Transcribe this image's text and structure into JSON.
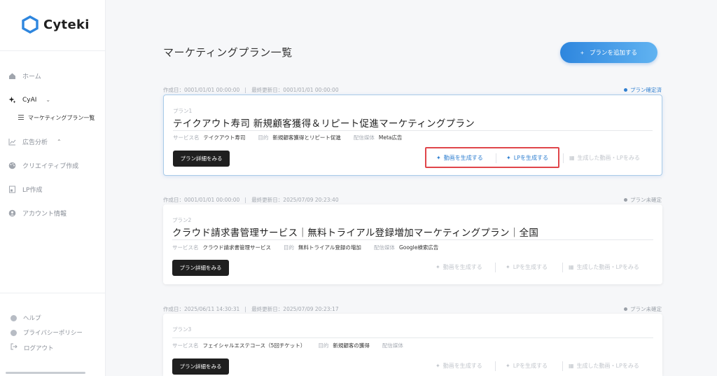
{
  "brand": {
    "name": "Cyteki",
    "accent": "#2e86de"
  },
  "sidebar": {
    "nav": [
      {
        "label": "ホーム",
        "icon": "home-icon"
      },
      {
        "label": "CyAI",
        "icon": "sparkle-icon",
        "expanded": true
      },
      {
        "label": "広告分析",
        "icon": "chart-icon"
      },
      {
        "label": "クリエイティブ作成",
        "icon": "palette-icon"
      },
      {
        "label": "LP作成",
        "icon": "document-icon"
      },
      {
        "label": "アカウント情報",
        "icon": "user-icon"
      }
    ],
    "sub_item": {
      "label": "マーケティングプラン一覧",
      "icon": "list-icon"
    },
    "bottom": [
      {
        "label": "ヘルプ",
        "icon": "help-icon"
      },
      {
        "label": "プライバシーポリシー",
        "icon": "info-icon"
      },
      {
        "label": "ログアウト",
        "icon": "logout-icon"
      }
    ]
  },
  "main": {
    "title": "マーケティングプラン一覧",
    "add_button": "プランを追加する",
    "labels": {
      "created": "作成日：",
      "updated": "最終更新日：",
      "service": "サービス名",
      "objective": "目的",
      "media": "配信媒体",
      "detail_button": "プラン詳細をみる",
      "gen_video": "動画を生成する",
      "gen_lp": "LPを生成する",
      "view_generated": "生成した動画・LPをみる"
    },
    "plans": [
      {
        "created": "0001/01/01 00:00:00",
        "updated": "0001/01/01 00:00:00",
        "status": "プラン確定済",
        "number": "プラン1",
        "title": "テイクアウト寿司 新規顧客獲得＆リピート促進マーケティングプラン",
        "service": "テイクアウト寿司",
        "objective": "新規顧客獲得とリピート促進",
        "media": "Meta広告"
      },
      {
        "created": "0001/01/01 00:00:00",
        "updated": "2025/07/09 20:23:40",
        "status": "プラン未確定",
        "number": "プラン2",
        "title": "クラウド請求書管理サービス｜無料トライアル登録増加マーケティングプラン｜全国",
        "service": "クラウド請求書管理サービス",
        "objective": "無料トライアル登録の増加",
        "media": "Google検索広告"
      },
      {
        "created": "2025/06/11 14:30:31",
        "updated": "2025/07/09 20:23:17",
        "status": "プラン未確定",
        "number": "プラン3",
        "title": "",
        "service": "フェイシャルエステコース（5回チケット）",
        "objective": "新規顧客の獲得",
        "media": ""
      }
    ]
  }
}
